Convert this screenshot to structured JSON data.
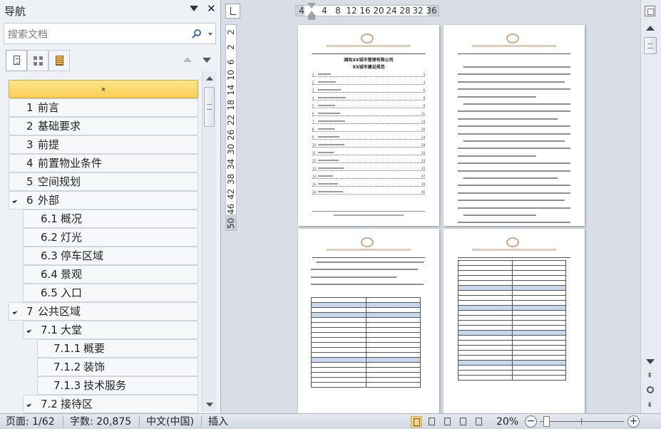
{
  "nav": {
    "title": "导航",
    "close_glyph": "✕",
    "search_placeholder": "搜索文档",
    "tabs": [
      "headings-icon",
      "pages-icon",
      "results-icon"
    ],
    "collapse_glyph": "⌅",
    "outline": [
      {
        "num": "1",
        "label": "前言",
        "level": 1,
        "expandable": false
      },
      {
        "num": "2",
        "label": "基础要求",
        "level": 1,
        "expandable": false
      },
      {
        "num": "3",
        "label": "前提",
        "level": 1,
        "expandable": false
      },
      {
        "num": "4",
        "label": "前置物业条件",
        "level": 1,
        "expandable": false
      },
      {
        "num": "5",
        "label": "空间规划",
        "level": 1,
        "expandable": false
      },
      {
        "num": "6",
        "label": "外部",
        "level": 1,
        "expandable": true
      },
      {
        "num": "6.1",
        "label": "概况",
        "level": 2,
        "expandable": false
      },
      {
        "num": "6.2",
        "label": "灯光",
        "level": 2,
        "expandable": false
      },
      {
        "num": "6.3",
        "label": "停车区域",
        "level": 2,
        "expandable": false
      },
      {
        "num": "6.4",
        "label": "景观",
        "level": 2,
        "expandable": false
      },
      {
        "num": "6.5",
        "label": "入口",
        "level": 2,
        "expandable": false
      },
      {
        "num": "7",
        "label": "公共区域",
        "level": 1,
        "expandable": true
      },
      {
        "num": "7.1",
        "label": "大堂",
        "level": 2,
        "expandable": true
      },
      {
        "num": "7.1.1",
        "label": "概要",
        "level": 3,
        "expandable": false
      },
      {
        "num": "7.1.2",
        "label": "装饰",
        "level": 3,
        "expandable": false
      },
      {
        "num": "7.1.3",
        "label": "技术服务",
        "level": 3,
        "expandable": false
      },
      {
        "num": "7.2",
        "label": "接待区",
        "level": 2,
        "expandable": true
      }
    ]
  },
  "ruler": {
    "horizontal_ticks": [
      "4",
      "4",
      "8",
      "12",
      "16",
      "20",
      "24",
      "28",
      "32",
      "36"
    ],
    "vertical_ticks": [
      "2",
      "2",
      "6",
      "10",
      "14",
      "18",
      "22",
      "26",
      "30",
      "34",
      "38",
      "42",
      "46",
      "50"
    ]
  },
  "pages": {
    "page1": {
      "title_line1": "国际XX城市管理有限公司",
      "title_line2": "XX城市建设规范",
      "toc": [
        {
          "n": "1",
          "p": "3"
        },
        {
          "n": "2",
          "p": "4"
        },
        {
          "n": "3",
          "p": "6"
        },
        {
          "n": "4",
          "p": "8"
        },
        {
          "n": "5",
          "p": "9"
        },
        {
          "n": "6",
          "p": "11"
        },
        {
          "n": "7",
          "p": "14"
        },
        {
          "n": "8",
          "p": "20"
        },
        {
          "n": "9",
          "p": "24"
        },
        {
          "n": "10",
          "p": "28"
        },
        {
          "n": "11",
          "p": "30"
        },
        {
          "n": "12",
          "p": "33"
        },
        {
          "n": "13",
          "p": "35"
        },
        {
          "n": "14",
          "p": "37"
        },
        {
          "n": "15",
          "p": "39"
        },
        {
          "n": "16",
          "p": "40"
        }
      ]
    }
  },
  "status": {
    "page": "页面: 1/62",
    "words": "字数: 20,875",
    "language": "中文(中国)",
    "mode": "插入",
    "zoom": "20%",
    "zoom_level_percent": 20,
    "minus": "−",
    "plus": "+"
  },
  "colors": {
    "selected_row": "#f9cf53",
    "table_highlight": "#c6d7ee",
    "accent_blue": "#3b6fb6"
  }
}
